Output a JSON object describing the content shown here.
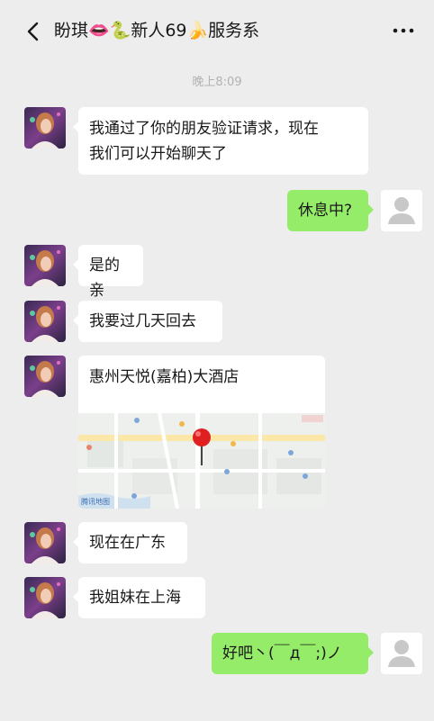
{
  "header": {
    "title": "盼琪👄🐍新人69🍌服务系",
    "back_icon": "chevron-left-icon",
    "more_icon": "more-dots-icon"
  },
  "timestamp": "晚上8:09",
  "messages": [
    {
      "side": "left",
      "line1": "我通过了你的朋友验证请求，现在",
      "line2": "我们可以开始聊天了"
    },
    {
      "side": "right",
      "text": "休息中?"
    },
    {
      "side": "left",
      "text": "是的亲"
    },
    {
      "side": "left",
      "text": "我要过几天回去"
    },
    {
      "side": "left",
      "type": "location",
      "name": "惠州天悦(嘉柏)大酒店",
      "map_watermark": "腾讯地图"
    },
    {
      "side": "left",
      "text": "现在在广东"
    },
    {
      "side": "left",
      "text": "我姐妹在上海"
    },
    {
      "side": "right",
      "text": "好吧丶(￣д￣;)ノ"
    }
  ],
  "colors": {
    "background": "#ededed",
    "bubble_self": "#95ec69",
    "bubble_other": "#ffffff",
    "location_pin": "#e02020"
  }
}
